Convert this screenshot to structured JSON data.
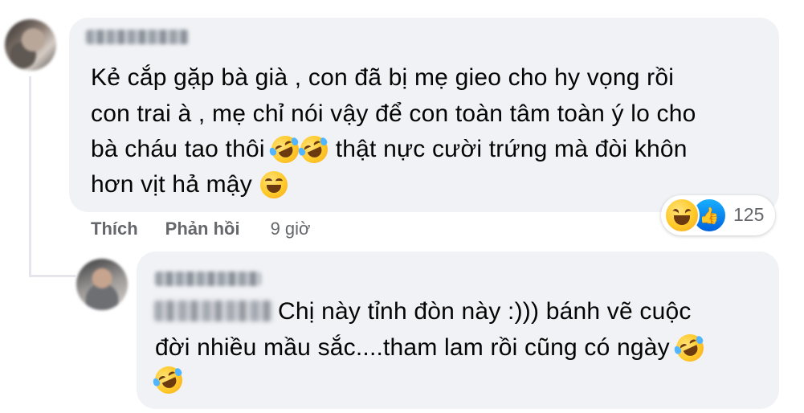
{
  "comment": {
    "lines": [
      "Kẻ cắp gặp bà già , con đã bị mẹ gieo cho hy vọng rồi",
      "con trai à , mẹ chỉ nói vậy để con toàn tâm toàn ý lo cho",
      "bà cháu tao thôi",
      "thật nực cười trứng mà đòi khôn",
      "hơn vịt hả mậy"
    ],
    "actions": {
      "like": "Thích",
      "reply": "Phản hồi",
      "time": "9 giờ"
    },
    "reactions": {
      "count": "125",
      "types": [
        "haha-icon",
        "like-icon"
      ]
    }
  },
  "reply": {
    "lines": [
      "Chị này tỉnh đòn này :))) bánh vẽ cuộc",
      "đời nhiều mầu sắc....tham lam rồi cũng có ngày"
    ]
  }
}
